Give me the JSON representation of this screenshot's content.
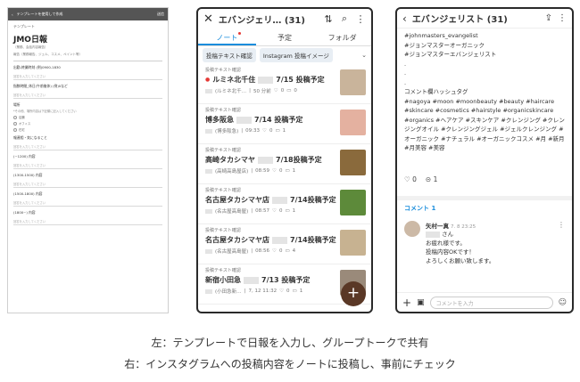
{
  "phone_form": {
    "header_title": "テンプレートを使用して作成",
    "header_right": "送信",
    "template_label": "テンプレート",
    "title": "JMO日報",
    "subtitle": "（業務、会話内容報告）",
    "description": "報告（業務報告、ジェル、コスメ、ペイント等）",
    "fields": [
      {
        "label": "出勤-終業時刻 (例)0900-1830",
        "hint": "",
        "placeholder": "回答を入力してください"
      },
      {
        "label": "指数時間_休日(午前後休) (例)0など",
        "hint": "",
        "placeholder": "回答を入力してください"
      },
      {
        "label": "場所",
        "hint": "*その他、場所内容は下記欄に記入してください",
        "placeholder": "",
        "options": [
          "店舗",
          "オフィス",
          "在宅"
        ]
      },
      {
        "label": "報連相・気になること",
        "hint": "",
        "placeholder": "回答を入力してください"
      },
      {
        "label": "(~1200) 内容",
        "hint": "",
        "placeholder": "回答を入力してください"
      },
      {
        "label": "(1300-1500) 内容",
        "hint": "",
        "placeholder": "回答を入力してください"
      },
      {
        "label": "(1500-1800) 内容",
        "hint": "",
        "placeholder": "回答を入力してください"
      },
      {
        "label": "(1800~) 内容",
        "hint": "",
        "placeholder": "回答を入力してください"
      }
    ]
  },
  "phone_notes": {
    "title": "エバンジェリ…",
    "count": "(31)",
    "tabs": [
      "ノート",
      "予定",
      "フォルダ"
    ],
    "chips": [
      "投稿テキスト確認",
      "Instagram 投稿イメージ"
    ],
    "items": [
      {
        "tag": "投稿テキスト確認",
        "name": "ルミネ北千住",
        "date": "7/15 投稿予定",
        "meta_author": "(ルミネ北千…",
        "meta_time": "50 分前",
        "likes": "0",
        "comments": "0",
        "new": true,
        "thumb_color": "#c9b49b"
      },
      {
        "tag": "投稿テキスト確認",
        "name": "博多阪急",
        "date": "7/14 投稿予定",
        "meta_author": "(博多阪急)",
        "meta_time": "09:33",
        "likes": "0",
        "comments": "1",
        "new": false,
        "thumb_color": "#e4b1a0"
      },
      {
        "tag": "投稿テキスト確認",
        "name": "高崎タカシマヤ",
        "date": "7/18投稿予定",
        "meta_author": "(高崎高島屋店)",
        "meta_time": "08:59",
        "likes": "0",
        "comments": "1",
        "new": false,
        "thumb_color": "#8a6a3c"
      },
      {
        "tag": "投稿テキスト確認",
        "name": "名古屋タカシマヤ店",
        "date": "7/14投稿予定",
        "meta_author": "(名古屋高島屋)",
        "meta_time": "08:57",
        "likes": "0",
        "comments": "1",
        "new": false,
        "thumb_color": "#5d8a3a"
      },
      {
        "tag": "投稿テキスト確認",
        "name": "名古屋タカシマヤ店",
        "date": "7/14投稿予定",
        "meta_author": "(名古屋高島屋)",
        "meta_time": "08:56",
        "likes": "0",
        "comments": "4",
        "new": false,
        "thumb_color": "#c7b291"
      },
      {
        "tag": "投稿テキスト確認",
        "name": "新宿小田急",
        "date": "7/13 投稿予定",
        "meta_author": "(小田急新…",
        "meta_time": "7, 12 11:32",
        "likes": "0",
        "comments": "1",
        "new": false,
        "thumb_color": "#9a8a7a"
      }
    ]
  },
  "phone_post": {
    "title": "エバンジェリスト (31)",
    "lines": [
      "#johnmasters_evangelist",
      "#ジョンマスターオーガニック",
      "#ジョンマスターエバンジェリスト",
      ".",
      ".",
      ".",
      "コメント欄ハッシュタグ"
    ],
    "hashtags": "#nagoya #moon #moonbeauty #beauty #haircare #skincare #cosmetics #hairstyle #organicskincare #organics #ヘアケア #スキンケア #クレンジング #クレンジングオイル #クレンジングジェル #ジェルクレンジング #オーガニック #ナチュラル #オーガニックコスメ #月 #新月 #月美容 #美容",
    "likes": "0",
    "comments_count": "1",
    "comment_header": "コメント",
    "comment_header_count": "1",
    "commenter": "矢村一真",
    "comment_time": "7. 8 23:25",
    "comment_lines": [
      "さん",
      "お疲れ様です。",
      "投稿内容OKです！",
      "よろしくお願い致します。"
    ],
    "input_placeholder": "コメントを入力"
  },
  "captions": [
    "左：テンプレートで日報を入力し、グループトークで共有",
    "右：インスタグラムへの投稿内容をノートに投稿し、事前にチェック"
  ]
}
